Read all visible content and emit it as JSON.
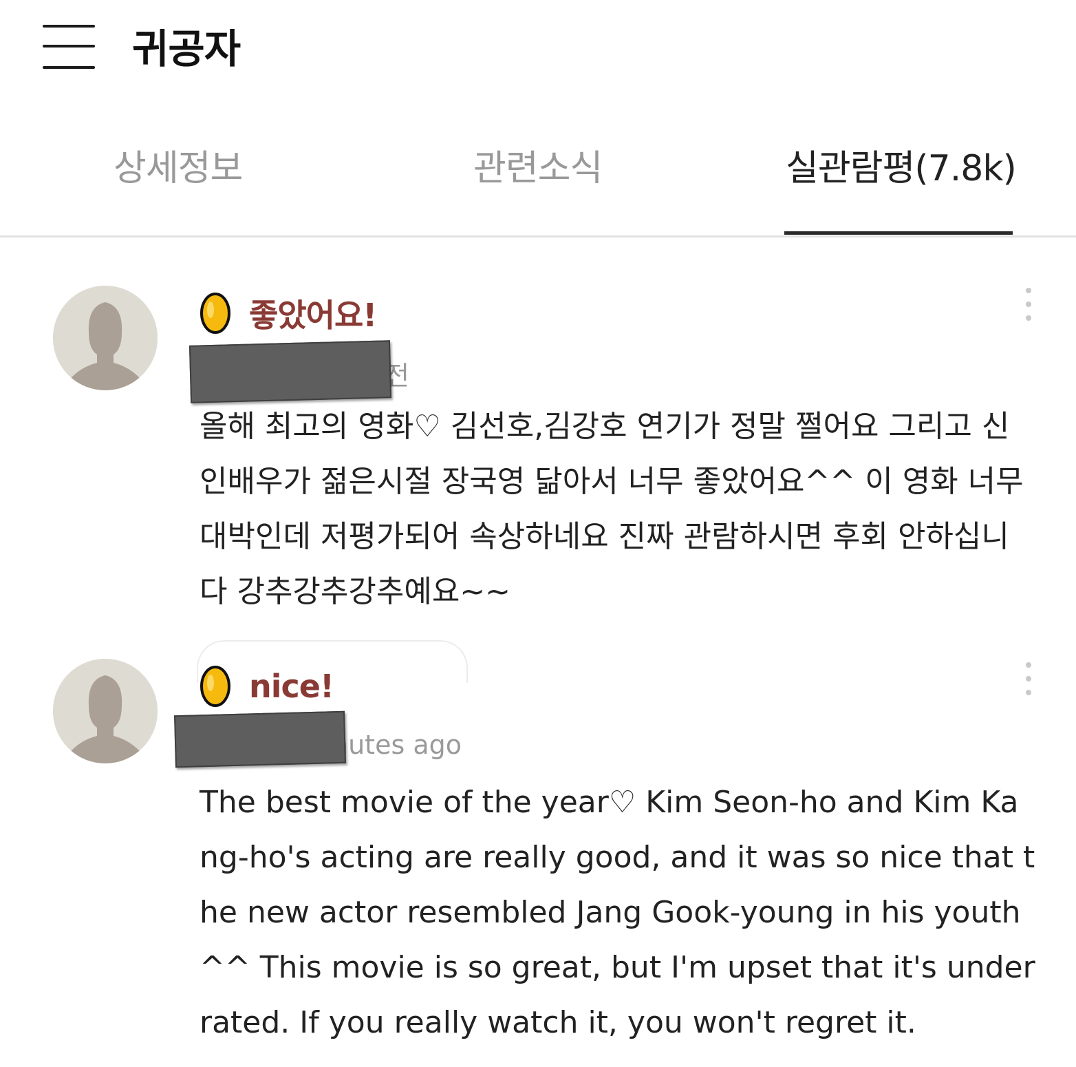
{
  "header": {
    "title": "귀공자"
  },
  "tabs": [
    {
      "label": "상세정보"
    },
    {
      "label": "관련소식"
    },
    {
      "label": "실관람평(7.8k)"
    }
  ],
  "reviews": [
    {
      "rating_label": "좋았어요!",
      "meta_visible": "전",
      "body": "올해 최고의 영화♡ 김선호,김강호 연기가 정말 쩔어요 그리고 신인배우가 젊은시절 장국영 닮아서 너무 좋았어요^^ 이 영화 너무 대박인데 저평가되어 속상하네요 진짜 관람하시면 후회 안하십니다 강추강추강추예요~~"
    },
    {
      "rating_label": "nice!",
      "meta_visible": "nutes ago",
      "body": "The best movie of the year♡ Kim Seon-ho and Kim Kang-ho's acting are really good, and it was so nice that the new actor resembled Jang Gook-young in his youth ^^ This movie is so great, but I'm upset that it's underrated. If you really watch it, you won't regret it."
    }
  ],
  "colors": {
    "rating_label": "#8a3a34",
    "coin": "#f4b400",
    "active_tab": "#222222",
    "inactive_tab": "#999999"
  }
}
